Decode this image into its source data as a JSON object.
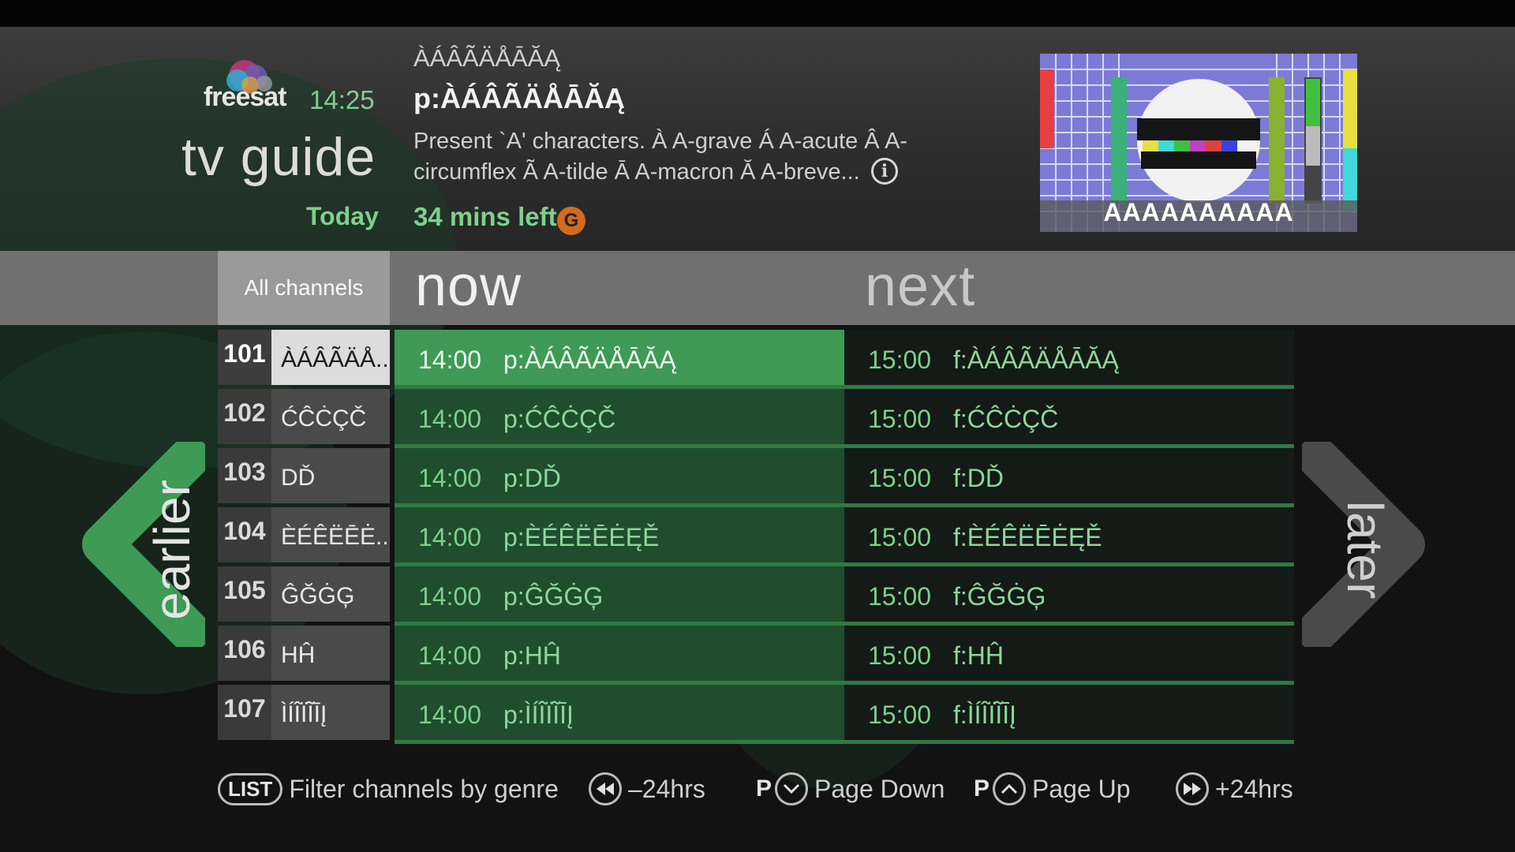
{
  "header": {
    "brand": "freesat",
    "clock": "14:25",
    "title": "tv guide",
    "day": "Today",
    "channel_name": "ÀÁÂÃÄÅĀĂĄ",
    "programme_title": "p:ÀÁÂÃÄÅĀĂĄ",
    "description": "Present `A' characters. À A-grave Á A-acute Â A-circumflex Ã A-tilde Ā A-macron Ă A-breve...",
    "time_left": "34 mins left",
    "rating": "G",
    "preview_caption": "AAAAAAAAAA"
  },
  "columns": {
    "filter": "All channels",
    "now": "now",
    "next": "next"
  },
  "channels": [
    {
      "number": "101",
      "name": "ÀÁÂÃÄÅ...",
      "now_time": "14:00",
      "now_title": "p:ÀÁÂÃÄÅĀĂĄ",
      "next_time": "15:00",
      "next_title": "f:ÀÁÂÃÄÅĀĂĄ"
    },
    {
      "number": "102",
      "name": "ĆĈĊÇČ",
      "now_time": "14:00",
      "now_title": "p:ĆĈĊÇČ",
      "next_time": "15:00",
      "next_title": "f:ĆĈĊÇČ"
    },
    {
      "number": "103",
      "name": "DĎ",
      "now_time": "14:00",
      "now_title": "p:DĎ",
      "next_time": "15:00",
      "next_title": "f:DĎ"
    },
    {
      "number": "104",
      "name": "ÈÉÊËĒĖ...",
      "now_time": "14:00",
      "now_title": "p:ÈÉÊËĒĖĘĚ",
      "next_time": "15:00",
      "next_title": "f:ÈÉÊËĒĖĘĚ"
    },
    {
      "number": "105",
      "name": "ĜĞĠĢ",
      "now_time": "14:00",
      "now_title": "p:ĜĞĠĢ",
      "next_time": "15:00",
      "next_title": "f:ĜĞĠĢ"
    },
    {
      "number": "106",
      "name": "HĤ",
      "now_time": "14:00",
      "now_title": "p:HĤ",
      "next_time": "15:00",
      "next_title": "f:HĤ"
    },
    {
      "number": "107",
      "name": "ÌÍÎÏĨĪĮ",
      "now_time": "14:00",
      "now_title": "p:ÌÍÎÏĨĪĮ",
      "next_time": "15:00",
      "next_title": "f:ÌÍÎÏĨĪĮ"
    }
  ],
  "nav": {
    "earlier": "earlier",
    "later": "later"
  },
  "footer": {
    "list_key": "LIST",
    "list_label": "Filter channels by genre",
    "back_label": "–24hrs",
    "page_key": "P",
    "page_down_label": "Page Down",
    "page_up_label": "Page Up",
    "forward_label": "+24hrs"
  },
  "colors": {
    "accent_green": "#7ed08c",
    "selected_now": "#3e9a55",
    "now_column": "#1f4d2e",
    "rating_orange": "#d36a1e"
  },
  "icons": [
    "info-icon",
    "rewind-icon",
    "chevron-down-icon",
    "chevron-up-icon",
    "fast-forward-icon",
    "left-arrow-icon",
    "right-arrow-icon",
    "freesat-logo"
  ]
}
